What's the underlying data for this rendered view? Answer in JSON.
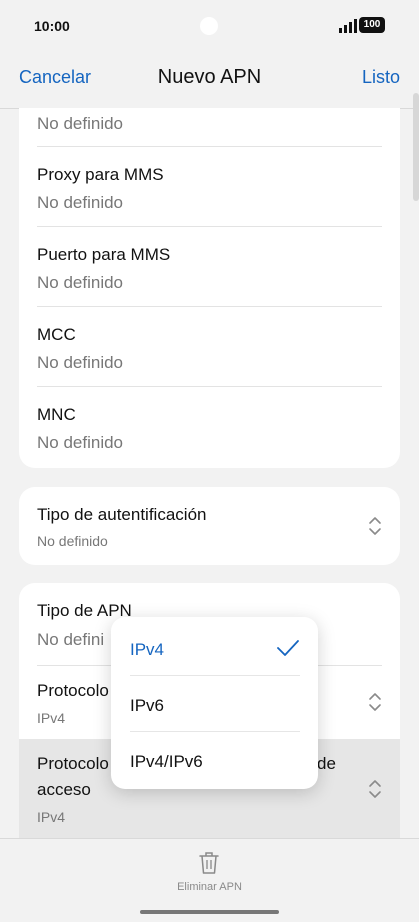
{
  "status": {
    "time": "10:00",
    "battery": "100"
  },
  "nav": {
    "cancel": "Cancelar",
    "title": "Nuevo APN",
    "done": "Listo"
  },
  "card1": {
    "partial_value": "No definido",
    "rows": [
      {
        "label": "Proxy para MMS",
        "value": "No definido"
      },
      {
        "label": "Puerto para MMS",
        "value": "No definido"
      },
      {
        "label": "MCC",
        "value": "No definido"
      },
      {
        "label": "MNC",
        "value": "No definido"
      }
    ]
  },
  "card2": {
    "label": "Tipo de autentificación",
    "value": "No definido"
  },
  "card3": {
    "apn_type": {
      "label": "Tipo de APN",
      "value": "No defini"
    },
    "protocol": {
      "label": "Protocolo",
      "value": "IPv4"
    },
    "roaming_protocol": {
      "label_line1": "Protocolo",
      "label_tail": "de",
      "label_line2": "acceso",
      "value": "IPv4"
    }
  },
  "dropdown": {
    "options": [
      {
        "label": "IPv4",
        "selected": true
      },
      {
        "label": "IPv6",
        "selected": false
      },
      {
        "label": "IPv4/IPv6",
        "selected": false
      }
    ]
  },
  "bottom": {
    "delete_label": "Eliminar APN"
  },
  "icons": {
    "chevron": "chevron-up-down-icon",
    "check": "check-icon",
    "trash": "trash-icon"
  },
  "colors": {
    "accent": "#1565c0",
    "background": "#f2f2f2",
    "card": "#ffffff",
    "highlight": "#e6e6e6"
  }
}
